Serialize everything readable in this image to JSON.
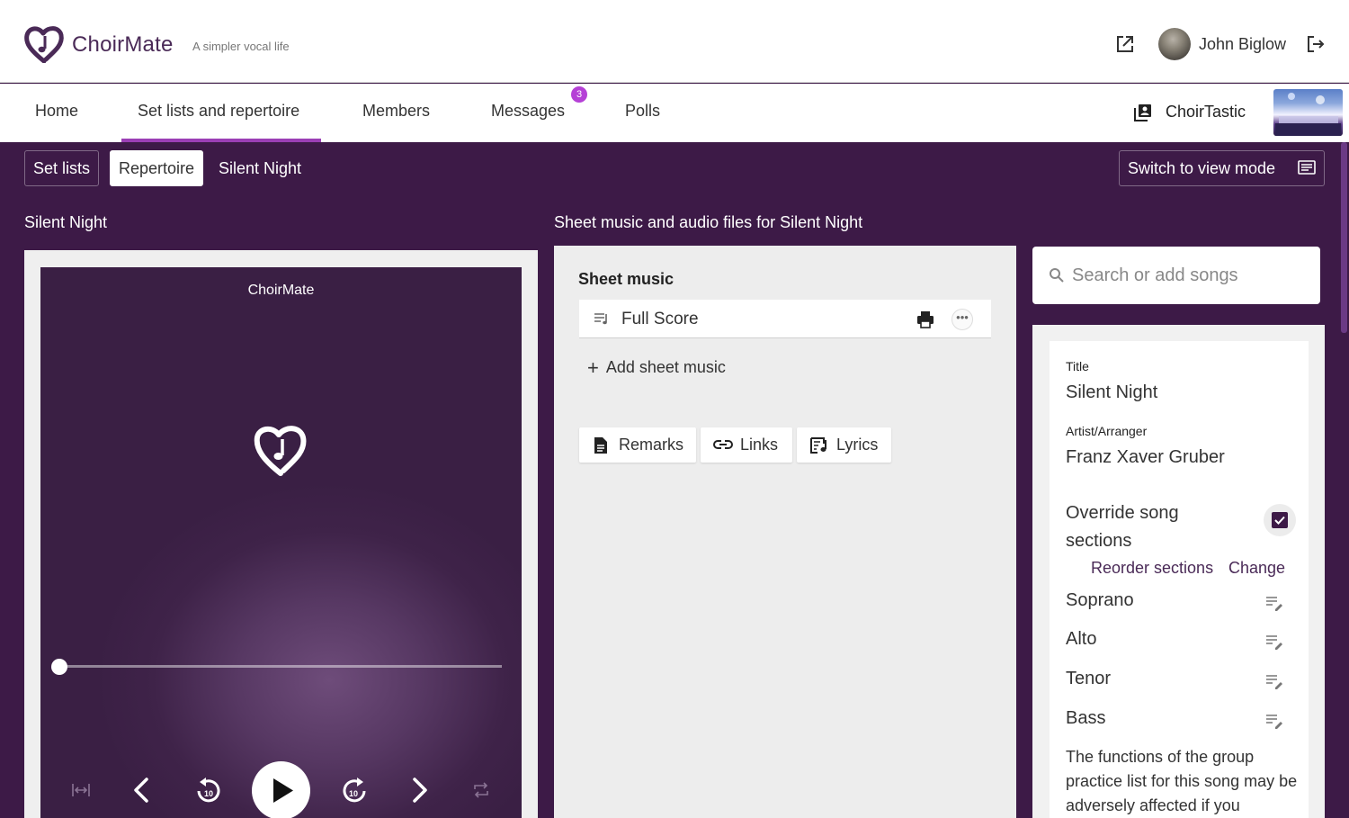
{
  "app": {
    "name": "ChoirMate",
    "tagline": "A simpler vocal life"
  },
  "user": {
    "name": "John Biglow"
  },
  "nav": {
    "items": [
      "Home",
      "Set lists and repertoire",
      "Members",
      "Messages",
      "Polls"
    ],
    "active": "Set lists and repertoire",
    "messages_badge": "3"
  },
  "choir": {
    "name": "ChoirTastic"
  },
  "subnav": {
    "set_lists": "Set lists",
    "repertoire": "Repertoire",
    "current": "Silent Night",
    "switch_mode": "Switch to view mode"
  },
  "song_panel": {
    "title": "Silent Night"
  },
  "player": {
    "title": "ChoirMate",
    "progress": 0
  },
  "files_panel": {
    "title": "Sheet music and audio files for Silent Night",
    "sheet_heading": "Sheet music",
    "score_label": "Full Score",
    "add_sheet": "Add sheet music",
    "remarks": "Remarks",
    "links": "Links",
    "lyrics": "Lyrics"
  },
  "search": {
    "placeholder": "Search or add songs"
  },
  "details": {
    "title_label": "Title",
    "title_value": "Silent Night",
    "artist_label": "Artist/Arranger",
    "artist_value": "Franz Xaver Gruber",
    "override_label": "Override song sections",
    "override_checked": true,
    "reorder": "Reorder sections",
    "change": "Change",
    "sections": [
      "Soprano",
      "Alto",
      "Tenor",
      "Bass"
    ],
    "warning": "The functions of the group practice list for this song may be adversely affected if you"
  },
  "colors": {
    "brand": "#3d1a47",
    "accent": "#9b3fb5",
    "badge": "#b540d6"
  }
}
